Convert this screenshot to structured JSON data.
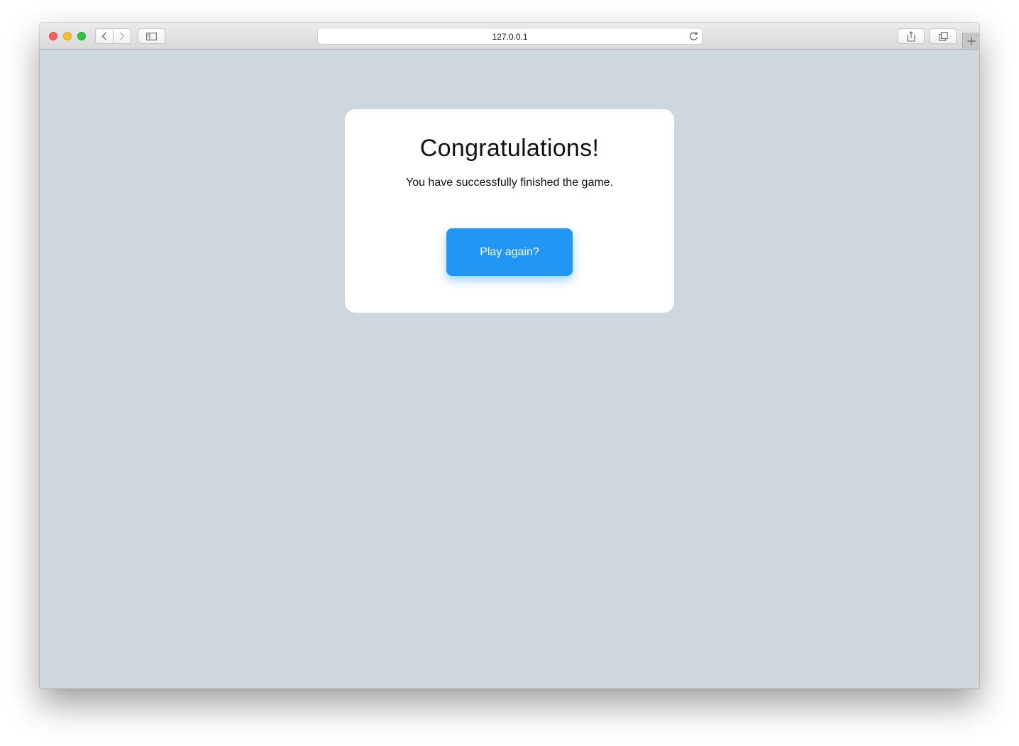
{
  "browser": {
    "url": "127.0.0.1",
    "icons": {
      "back": "chevron-left-icon",
      "forward": "chevron-right-icon",
      "sidebar": "sidebar-icon",
      "reload": "reload-icon",
      "share": "share-icon",
      "tabs": "tabs-overview-icon",
      "new_tab": "plus-icon"
    }
  },
  "page": {
    "background_color": "#cfd7de",
    "dialog": {
      "title": "Congratulations!",
      "message": "You have successfully finished the game.",
      "button_label": "Play again?",
      "button_color": "#2196f3"
    }
  }
}
